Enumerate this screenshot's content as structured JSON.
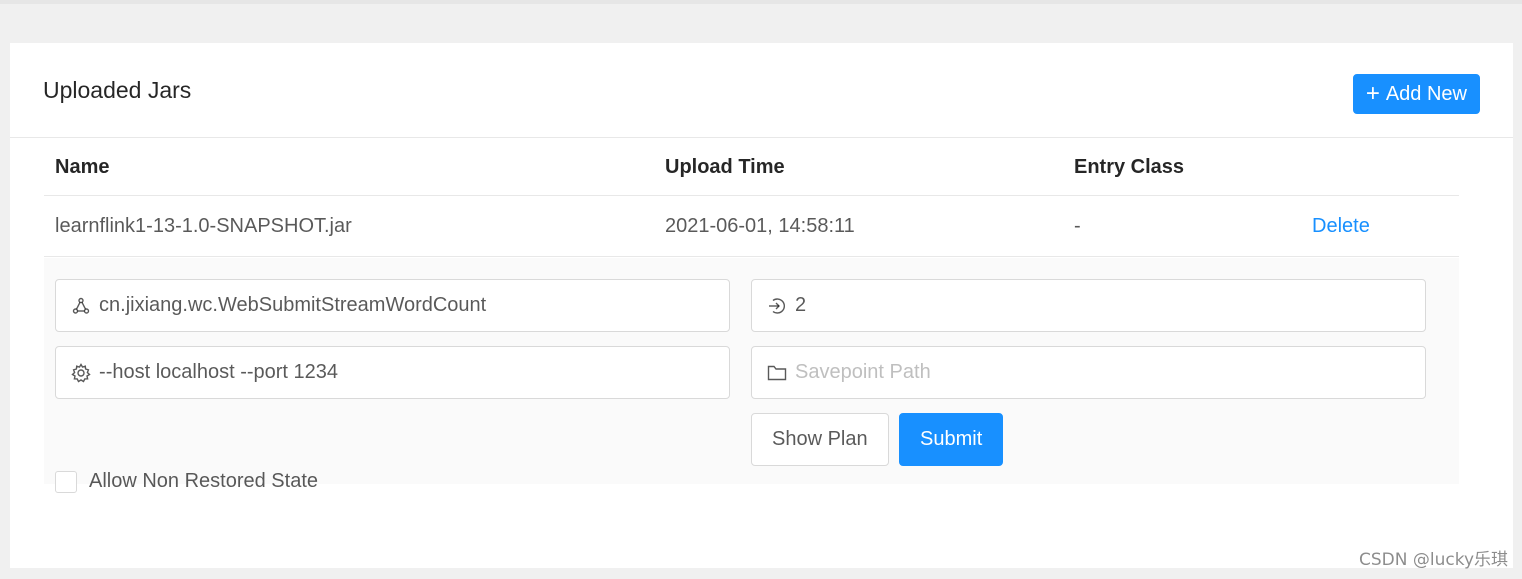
{
  "card": {
    "title": "Uploaded Jars",
    "add_button_label": "Add New"
  },
  "table": {
    "columns": [
      "Name",
      "Upload Time",
      "Entry Class",
      ""
    ],
    "rows": [
      {
        "name": "learnflink1-13-1.0-SNAPSHOT.jar",
        "upload_time": "2021-06-01, 14:58:11",
        "entry_class": "-",
        "action": "Delete"
      }
    ]
  },
  "submit_form": {
    "entry_class_value": "cn.jixiang.wc.WebSubmitStreamWordCount",
    "parallelism_value": "2",
    "program_args_value": "--host localhost --port 1234",
    "savepoint_placeholder": "Savepoint Path",
    "allow_non_restored_label": "Allow Non Restored State",
    "allow_non_restored_checked": false,
    "show_plan_label": "Show Plan",
    "submit_label": "Submit"
  },
  "colors": {
    "primary": "#1890ff",
    "background": "#f0f0f0"
  },
  "watermark": "CSDN @lucky乐琪"
}
